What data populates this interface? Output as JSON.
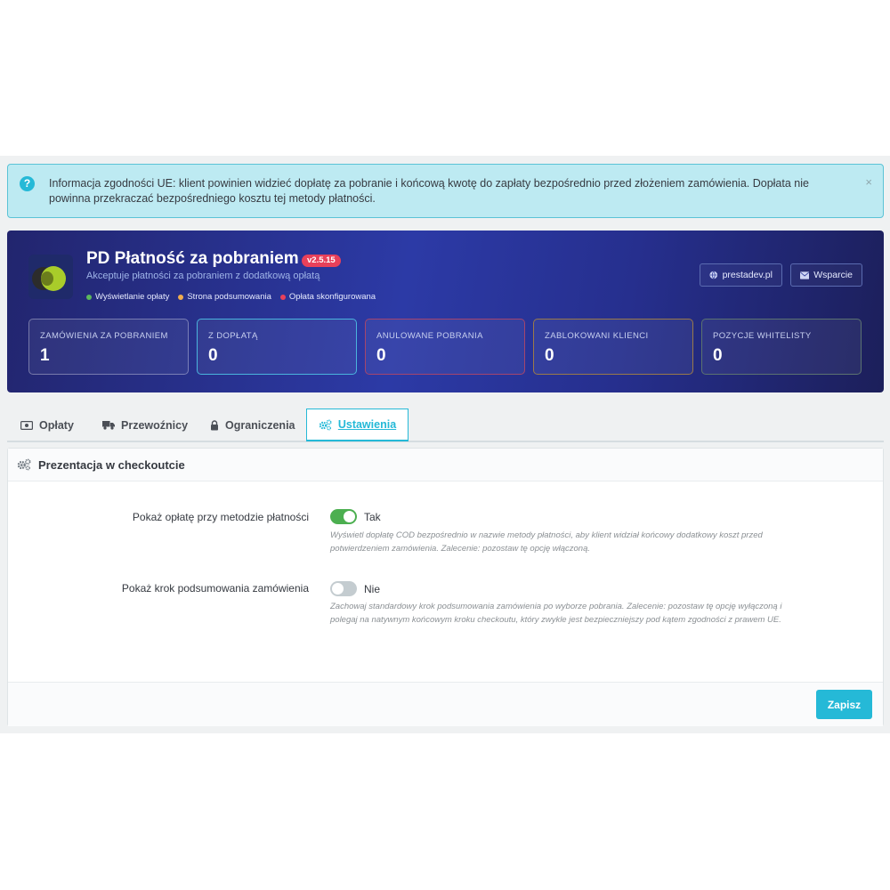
{
  "alert": {
    "message": "Informacja zgodności UE: klient powinien widzieć dopłatę za pobranie i końcową kwotę do zapłaty bezpośrednio przed złożeniem zamówienia. Dopłata nie powinna przekraczać bezpośredniego kosztu tej metody płatności.",
    "close_label": "×"
  },
  "module": {
    "title": "PD Płatność za pobraniem",
    "version": "v2.5.15",
    "subtitle": "Akceptuje płatności za pobraniem z dodatkową opłatą",
    "statuses": [
      {
        "label": "Wyświetlanie opłaty",
        "color": "#5cb85c"
      },
      {
        "label": "Strona podsumowania",
        "color": "#f0ad4e"
      },
      {
        "label": "Opłata skonfigurowana",
        "color": "#e8405a"
      }
    ],
    "website_label": "prestadev.pl",
    "support_label": "Wsparcie"
  },
  "stats": [
    {
      "label": "ZAMÓWIENIA ZA POBRANIEM",
      "value": "1"
    },
    {
      "label": "Z DOPŁATĄ",
      "value": "0"
    },
    {
      "label": "ANULOWANE POBRANIA",
      "value": "0"
    },
    {
      "label": "ZABLOKOWANI KLIENCI",
      "value": "0"
    },
    {
      "label": "POZYCJE WHITELISTY",
      "value": "0"
    }
  ],
  "tabs": [
    {
      "label": "Opłaty",
      "icon": "money-icon"
    },
    {
      "label": "Przewoźnicy",
      "icon": "truck-icon"
    },
    {
      "label": "Ograniczenia",
      "icon": "lock-icon"
    },
    {
      "label": "Ustawienia",
      "icon": "cogs-icon",
      "active": true
    }
  ],
  "panel": {
    "title": "Prezentacja w checkoutcie",
    "fields": [
      {
        "label": "Pokaż opłatę przy metodzie płatności",
        "state_text": "Tak",
        "enabled": true,
        "help": "Wyświetl dopłatę COD bezpośrednio w nazwie metody płatności, aby klient widział końcowy dodatkowy koszt przed potwierdzeniem zamówienia. Zalecenie: pozostaw tę opcję włączoną."
      },
      {
        "label": "Pokaż krok podsumowania zamówienia",
        "state_text": "Nie",
        "enabled": false,
        "help": "Zachowaj standardowy krok podsumowania zamówienia po wyborze pobrania. Zalecenie: pozostaw tę opcję wyłączoną i polegaj na natywnym końcowym kroku checkoutu, który zwykle jest bezpieczniejszy pod kątem zgodności z prawem UE."
      }
    ],
    "save_label": "Zapisz"
  },
  "colors": {
    "accent": "#25b9d7",
    "toggle_on": "#4caf50",
    "version_badge": "#e8405a"
  }
}
